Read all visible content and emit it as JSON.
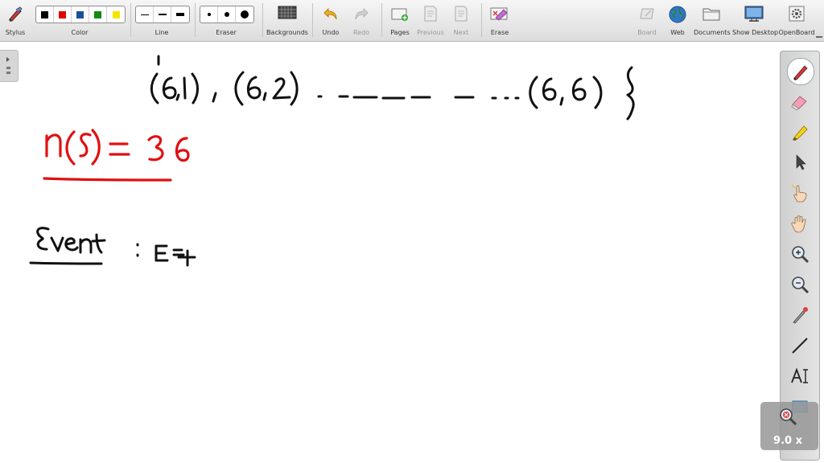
{
  "toolbar": {
    "stylus": "Stylus",
    "color": "Color",
    "line": "Line",
    "eraser": "Eraser",
    "backgrounds": "Backgrounds",
    "undo": "Undo",
    "redo": "Redo",
    "pages": "Pages",
    "previous": "Previous",
    "next": "Next",
    "erase": "Erase",
    "board": "Board",
    "web": "Web",
    "documents": "Documents",
    "show_desktop": "Show Desktop",
    "openboard": "OpenBoard"
  },
  "colors": [
    "#000000",
    "#e00000",
    "#1a4fa0",
    "#128a12",
    "#f4e600"
  ],
  "zoom": {
    "level": "9.0 x"
  },
  "ink_color_black": "#111111",
  "ink_color_red": "#e01010"
}
